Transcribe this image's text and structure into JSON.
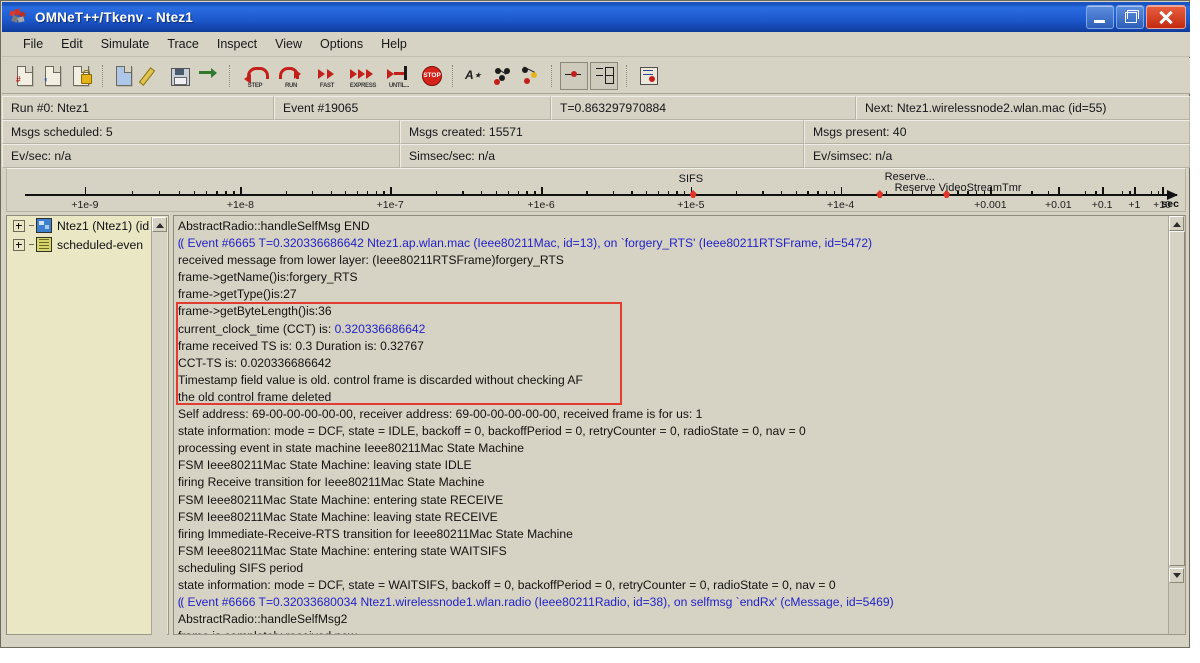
{
  "window": {
    "title": "OMNeT++/Tkenv - Ntez1",
    "app_icon": "omnet-logo-icon",
    "buttons": {
      "minimize": "minimize-button",
      "restore": "restore-button",
      "close": "close-button"
    }
  },
  "menubar": {
    "items": [
      "File",
      "Edit",
      "Simulate",
      "Trace",
      "Inspect",
      "View",
      "Options",
      "Help"
    ]
  },
  "toolbar": {
    "items": [
      {
        "name": "new-run-icon"
      },
      {
        "name": "copy-run-icon"
      },
      {
        "name": "load-ned-icon"
      },
      {
        "name": "open-file-icon"
      },
      {
        "name": "edit-ini-icon"
      },
      {
        "name": "save-icon"
      },
      {
        "name": "rebuild-network-icon"
      },
      {
        "name": "step-icon",
        "label": "STEP"
      },
      {
        "name": "run-icon",
        "label": "RUN"
      },
      {
        "name": "fast-run-icon",
        "label": "FAST"
      },
      {
        "name": "express-run-icon",
        "label": "EXPRESS"
      },
      {
        "name": "run-until-icon",
        "label": "UNTIL..."
      },
      {
        "name": "stop-icon",
        "label": "STOP"
      },
      {
        "name": "find-objects-icon"
      },
      {
        "name": "inspect-network-icon"
      },
      {
        "name": "inspect-objects-icon"
      },
      {
        "name": "timeline-toggle-icon"
      },
      {
        "name": "event-log-icon"
      },
      {
        "name": "options-icon"
      }
    ]
  },
  "status": {
    "row1": [
      {
        "name": "run-label",
        "text": "Run #0: Ntez1"
      },
      {
        "name": "event-label",
        "text": "Event #19065"
      },
      {
        "name": "time-label",
        "text": "T=0.863297970884"
      },
      {
        "name": "next-label",
        "text": "Next: Ntez1.wirelessnode2.wlan.mac (id=55)"
      }
    ],
    "row2": [
      {
        "name": "msgs-scheduled-label",
        "text": "Msgs scheduled: 5"
      },
      {
        "name": "msgs-created-label",
        "text": "Msgs created: 15571"
      },
      {
        "name": "msgs-present-label",
        "text": "Msgs present: 40"
      }
    ],
    "row3": [
      {
        "name": "ev-per-sec-label",
        "text": "Ev/sec: n/a"
      },
      {
        "name": "simsec-per-sec-label",
        "text": "Simsec/sec: n/a"
      },
      {
        "name": "ev-per-simsec-label",
        "text": "Ev/simsec: n/a"
      }
    ]
  },
  "timeline": {
    "unit_label": "sec",
    "major_ticks": [
      {
        "label": "+1e-9",
        "pos": 0.052
      },
      {
        "label": "+1e-8",
        "pos": 0.187
      },
      {
        "label": "+1e-7",
        "pos": 0.317
      },
      {
        "label": "+1e-6",
        "pos": 0.448
      },
      {
        "label": "+1e-5",
        "pos": 0.578
      },
      {
        "label": "+1e-4",
        "pos": 0.708
      },
      {
        "label": "+0.001",
        "pos": 0.838
      },
      {
        "label": "+0.01",
        "pos": 0.897
      },
      {
        "label": "+0.1",
        "pos": 0.935
      },
      {
        "label": "+1",
        "pos": 0.963
      },
      {
        "label": "+10",
        "pos": 0.987
      }
    ],
    "messages": [
      {
        "name": "SIFS",
        "pos": 0.58,
        "label_pos": 0.578,
        "label_dy": 0
      },
      {
        "name": "Reserve...",
        "pos": 0.742,
        "label_pos": 0.768,
        "label_dy": -2
      },
      {
        "name": "Reserve VideoStreamTmr",
        "pos": 0.8,
        "label_pos": 0.81,
        "label_dy": 9
      }
    ]
  },
  "tree": {
    "items": [
      {
        "name": "tree-item-network",
        "label": "Ntez1 (Ntez1) (id",
        "icon": "module-icon"
      },
      {
        "name": "tree-item-scheduled-events",
        "label": "scheduled-even",
        "icon": "list-icon"
      }
    ]
  },
  "log": {
    "lines": [
      {
        "t": "AbstractRadio::handleSelfMsg END",
        "c": "black"
      },
      {
        "t": "⸨ Event #6665  T=0.320336686642  Ntez1.ap.wlan.mac (Ieee80211Mac, id=13), on `forgery_RTS' (Ieee80211RTSFrame, id=5472)",
        "c": "blue"
      },
      {
        "t": "received message from lower layer: (Ieee80211RTSFrame)forgery_RTS",
        "c": "black"
      },
      {
        "t": "frame->getName()is:forgery_RTS",
        "c": "black"
      },
      {
        "t": "frame->getType()is:27",
        "c": "black"
      },
      {
        "t": "frame->getByteLength()is:36",
        "c": "black"
      },
      {
        "t": "current_clock_time (CCT) is:  0.320336686642",
        "c": "black",
        "blue_tail": "0.320336686642"
      },
      {
        "t": "frame received TS is:  0.3        Duration is: 0.32767",
        "c": "black"
      },
      {
        "t": "CCT-TS is:  0.020336686642",
        "c": "black"
      },
      {
        "t": "Timestamp field value is old. control frame is discarded without checking AF",
        "c": "black"
      },
      {
        "t": "the old control frame deleted",
        "c": "black"
      },
      {
        "t": "Self address: 69-00-00-00-00-00, receiver address: 69-00-00-00-00-00, received frame is for us: 1",
        "c": "black"
      },
      {
        "t": "state information: mode = DCF, state = IDLE, backoff = 0, backoffPeriod = 0, retryCounter = 0, radioState = 0, nav = 0",
        "c": "black"
      },
      {
        "t": "processing event in state machine Ieee80211Mac State Machine",
        "c": "black"
      },
      {
        "t": "FSM Ieee80211Mac State Machine: leaving state  IDLE",
        "c": "black"
      },
      {
        "t": "firing Receive transition for Ieee80211Mac State Machine",
        "c": "black"
      },
      {
        "t": "FSM Ieee80211Mac State Machine: entering state RECEIVE",
        "c": "black"
      },
      {
        "t": "FSM Ieee80211Mac State Machine: leaving state  RECEIVE",
        "c": "black"
      },
      {
        "t": "firing Immediate-Receive-RTS transition for Ieee80211Mac State Machine",
        "c": "black"
      },
      {
        "t": "FSM Ieee80211Mac State Machine: entering state WAITSIFS",
        "c": "black"
      },
      {
        "t": "scheduling SIFS period",
        "c": "black"
      },
      {
        "t": "state information: mode = DCF, state = WAITSIFS, backoff = 0, backoffPeriod = 0, retryCounter = 0, radioState = 0, nav = 0",
        "c": "black"
      },
      {
        "t": "⸨ Event #6666  T=0.32033680034  Ntez1.wirelessnode1.wlan.radio (Ieee80211Radio, id=38), on selfmsg `endRx' (cMessage, id=5469)",
        "c": "blue"
      },
      {
        "t": "AbstractRadio::handleSelfMsg2",
        "c": "black"
      },
      {
        "t": "frame is completely received now",
        "c": "black"
      }
    ],
    "highlight_box": "red-annotation-box"
  },
  "colors": {
    "titlebar": "#1e5ad0",
    "chrome": "#d6d3c4",
    "tree_bg": "#e9e7c4",
    "blue_text": "#2222c8",
    "red_box": "#e23b2f",
    "marker_red": "#e2342a"
  }
}
